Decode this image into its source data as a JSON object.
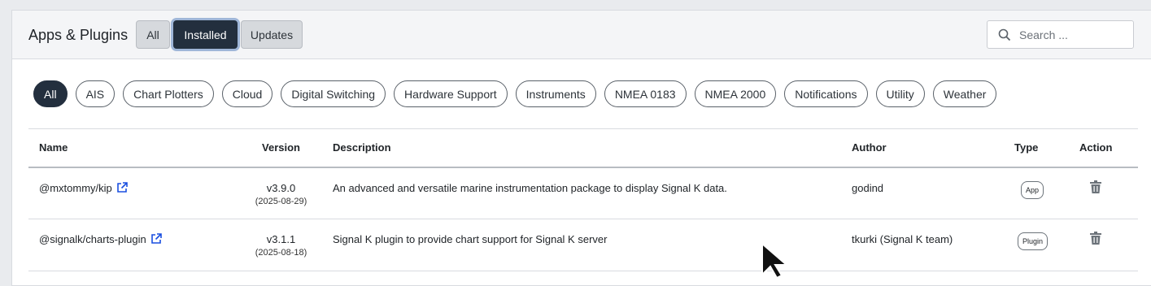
{
  "header": {
    "title": "Apps & Plugins",
    "tabs": [
      {
        "label": "All",
        "active": false
      },
      {
        "label": "Installed",
        "active": true
      },
      {
        "label": "Updates",
        "active": false
      }
    ],
    "search_placeholder": "Search ..."
  },
  "filters": [
    "All",
    "AIS",
    "Chart Plotters",
    "Cloud",
    "Digital Switching",
    "Hardware Support",
    "Instruments",
    "NMEA 0183",
    "NMEA 2000",
    "Notifications",
    "Utility",
    "Weather"
  ],
  "active_filter": "All",
  "table": {
    "columns": [
      "Name",
      "Version",
      "Description",
      "Author",
      "Type",
      "Action"
    ],
    "rows": [
      {
        "name": "@mxtommy/kip",
        "version": "v3.9.0",
        "date": "(2025-08-29)",
        "description": "An advanced and versatile marine instrumentation package to display Signal K data.",
        "author": "godind",
        "type": "App"
      },
      {
        "name": "@signalk/charts-plugin",
        "version": "v3.1.1",
        "date": "(2025-08-18)",
        "description": "Signal K plugin to provide chart support for Signal K server",
        "author": "tkurki (Signal K team)",
        "type": "Plugin"
      }
    ]
  },
  "icons": {
    "search": "search-icon",
    "external": "external-link-icon",
    "delete": "trash-icon"
  },
  "colors": {
    "accent": "#232f3e",
    "link": "#1a4fe0"
  }
}
